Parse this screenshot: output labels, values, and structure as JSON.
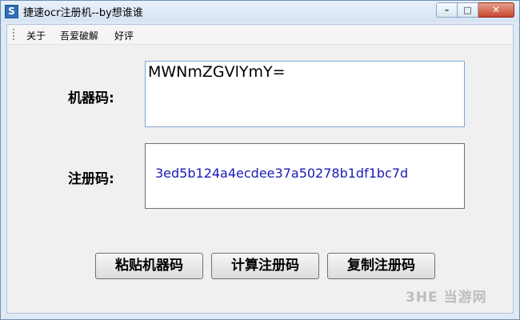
{
  "window": {
    "title": "捷速ocr注册机--by想谁谁",
    "icon_letter": "S",
    "controls": {
      "minimize": "–",
      "maximize": "□",
      "close": "✕"
    }
  },
  "menu": {
    "items": [
      {
        "label": "关于"
      },
      {
        "label": "吾爱破解"
      },
      {
        "label": "好评"
      }
    ]
  },
  "form": {
    "machine_code_label": "机器码:",
    "machine_code_value": "MWNmZGVlYmY=",
    "register_code_label": "注册码:",
    "register_code_value": "3ed5b124a4ecdee37a50278b1df1bc7d"
  },
  "buttons": {
    "paste_machine_code": "粘贴机器码",
    "calculate_register_code": "计算注册码",
    "copy_register_code": "复制注册码"
  },
  "watermark": {
    "text": "3HE 当游网"
  },
  "colors": {
    "register_code_text": "#1a1ab4",
    "close_button": "#c9472d",
    "window_frame": "#dfe9f5"
  }
}
